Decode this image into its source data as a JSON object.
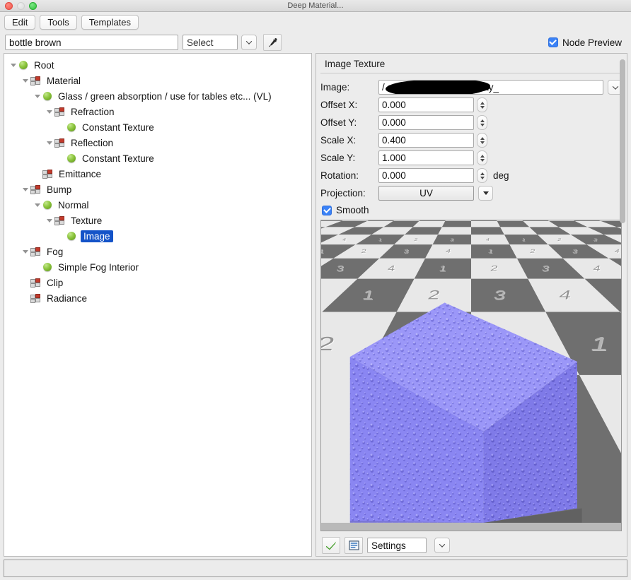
{
  "window": {
    "title": "Deep Material...",
    "controls": [
      "close",
      "minimize",
      "zoom"
    ]
  },
  "menubar": {
    "items": [
      {
        "label": "Edit"
      },
      {
        "label": "Tools"
      },
      {
        "label": "Templates"
      }
    ]
  },
  "namerow": {
    "name_value": "bottle brown",
    "name_placeholder": "",
    "select_value": "Select",
    "pipette_icon": "eyedropper-icon",
    "node_preview_label": "Node Preview",
    "node_preview_checked": true,
    "accent_color": "#3b82f6"
  },
  "tree": {
    "nodes": [
      {
        "label": "Root",
        "depth": 0,
        "icon": "sphere",
        "twisty": "open",
        "selected": false
      },
      {
        "label": "Material",
        "depth": 1,
        "icon": "blocks",
        "twisty": "open",
        "selected": false
      },
      {
        "label": "Glass / green absorption / use for tables etc... (VL)",
        "depth": 2,
        "icon": "sphere",
        "twisty": "open",
        "selected": false
      },
      {
        "label": "Refraction",
        "depth": 3,
        "icon": "blocks",
        "twisty": "open",
        "selected": false
      },
      {
        "label": "Constant Texture",
        "depth": 4,
        "icon": "sphere",
        "twisty": "none",
        "selected": false
      },
      {
        "label": "Reflection",
        "depth": 3,
        "icon": "blocks",
        "twisty": "open",
        "selected": false
      },
      {
        "label": "Constant Texture",
        "depth": 4,
        "icon": "sphere",
        "twisty": "none",
        "selected": false
      },
      {
        "label": "Emittance",
        "depth": 2,
        "icon": "blocks",
        "twisty": "none",
        "selected": false
      },
      {
        "label": "Bump",
        "depth": 1,
        "icon": "blocks",
        "twisty": "open",
        "selected": false
      },
      {
        "label": "Normal",
        "depth": 2,
        "icon": "sphere",
        "twisty": "open",
        "selected": false
      },
      {
        "label": "Texture",
        "depth": 3,
        "icon": "blocks",
        "twisty": "open",
        "selected": false
      },
      {
        "label": "Image",
        "depth": 4,
        "icon": "sphere",
        "twisty": "none",
        "selected": true
      },
      {
        "label": "Fog",
        "depth": 1,
        "icon": "blocks",
        "twisty": "open",
        "selected": false
      },
      {
        "label": "Simple Fog Interior",
        "depth": 2,
        "icon": "sphere",
        "twisty": "none",
        "selected": false
      },
      {
        "label": "Clip",
        "depth": 1,
        "icon": "blocks",
        "twisty": "none",
        "selected": false
      },
      {
        "label": "Radiance",
        "depth": 1,
        "icon": "blocks",
        "twisty": "none",
        "selected": false
      }
    ]
  },
  "properties": {
    "heading": "Image Texture",
    "image_label": "Image:",
    "image_path": "/                                esktop/Drops-HD-Quality_",
    "image_path_redacted": true,
    "fields": [
      {
        "label": "Offset X:",
        "value": "0.000",
        "unit": "",
        "spinner": true
      },
      {
        "label": "Offset Y:",
        "value": "0.000",
        "unit": "",
        "spinner": true
      },
      {
        "label": "Scale X:",
        "value": "0.400",
        "unit": "",
        "spinner": true
      },
      {
        "label": "Scale Y:",
        "value": "1.000",
        "unit": "",
        "spinner": true
      },
      {
        "label": "Rotation:",
        "value": "0.000",
        "unit": "deg",
        "spinner": true
      }
    ],
    "projection_label": "Projection:",
    "projection_value": "UV",
    "smooth_label": "Smooth",
    "smooth_checked": true
  },
  "preview": {
    "apply_icon": "green-check-icon",
    "list_icon": "list-view-icon",
    "settings_value": "Settings",
    "floor_numbers": [
      "1",
      "2",
      "3",
      "4"
    ],
    "cube_color": "#8a86f2",
    "floor_light_color": "#e8e8e8",
    "floor_dark_color": "#6f6f6f"
  },
  "statusbar": {
    "text": ""
  }
}
